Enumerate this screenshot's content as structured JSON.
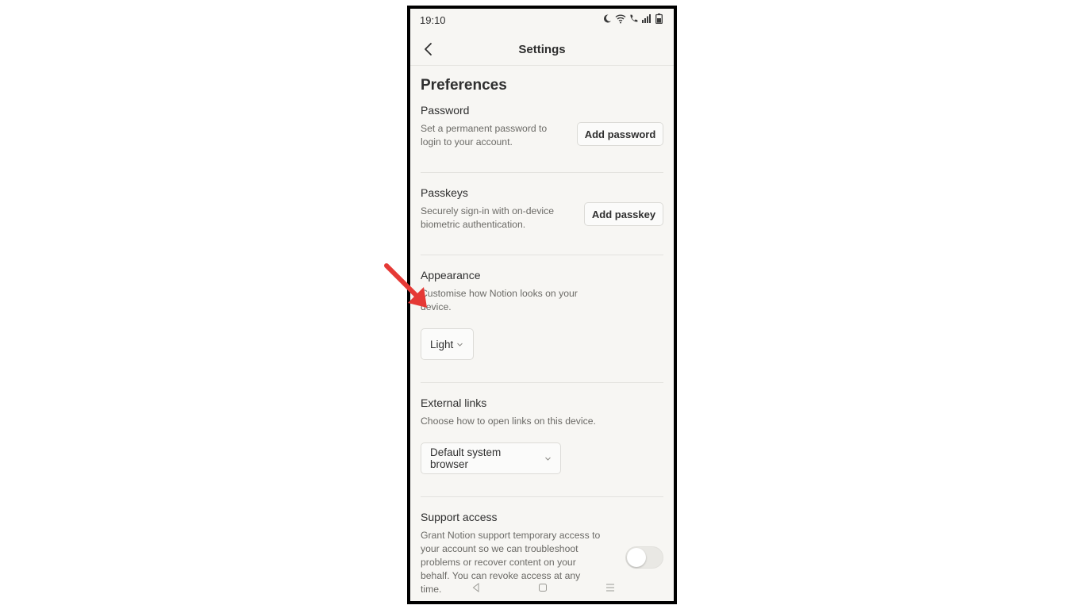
{
  "status_bar": {
    "time": "19:10",
    "icons": [
      "moon-icon",
      "wifi-icon",
      "call-icon",
      "signal-icon",
      "battery-icon"
    ]
  },
  "header": {
    "title": "Settings",
    "back_icon": "chevron-left-icon"
  },
  "preferences": {
    "heading": "Preferences",
    "password": {
      "title": "Password",
      "description_line1": "Set a permanent password to",
      "description_line2": "login to your account.",
      "button": "Add password"
    },
    "passkeys": {
      "title": "Passkeys",
      "description_line1": "Securely sign-in with on-device",
      "description_line2": "biometric authentication.",
      "button": "Add passkey"
    },
    "appearance": {
      "title": "Appearance",
      "description_line1": "Customise how Notion looks on your",
      "description_line2": "device.",
      "selected": "Light"
    },
    "external_links": {
      "title": "External links",
      "description": "Choose how to open links on this device.",
      "selected": "Default system browser"
    },
    "support_access": {
      "title": "Support access",
      "description_lines": [
        "Grant Notion support temporary access to",
        "your account so we can troubleshoot",
        "problems or recover content on your",
        "behalf. You can revoke access at any",
        "time."
      ],
      "enabled": false
    }
  },
  "navigation_bar": [
    "back-nav-icon",
    "home-nav-icon",
    "menu-nav-icon"
  ],
  "annotation": {
    "arrow_color": "#e53935"
  }
}
